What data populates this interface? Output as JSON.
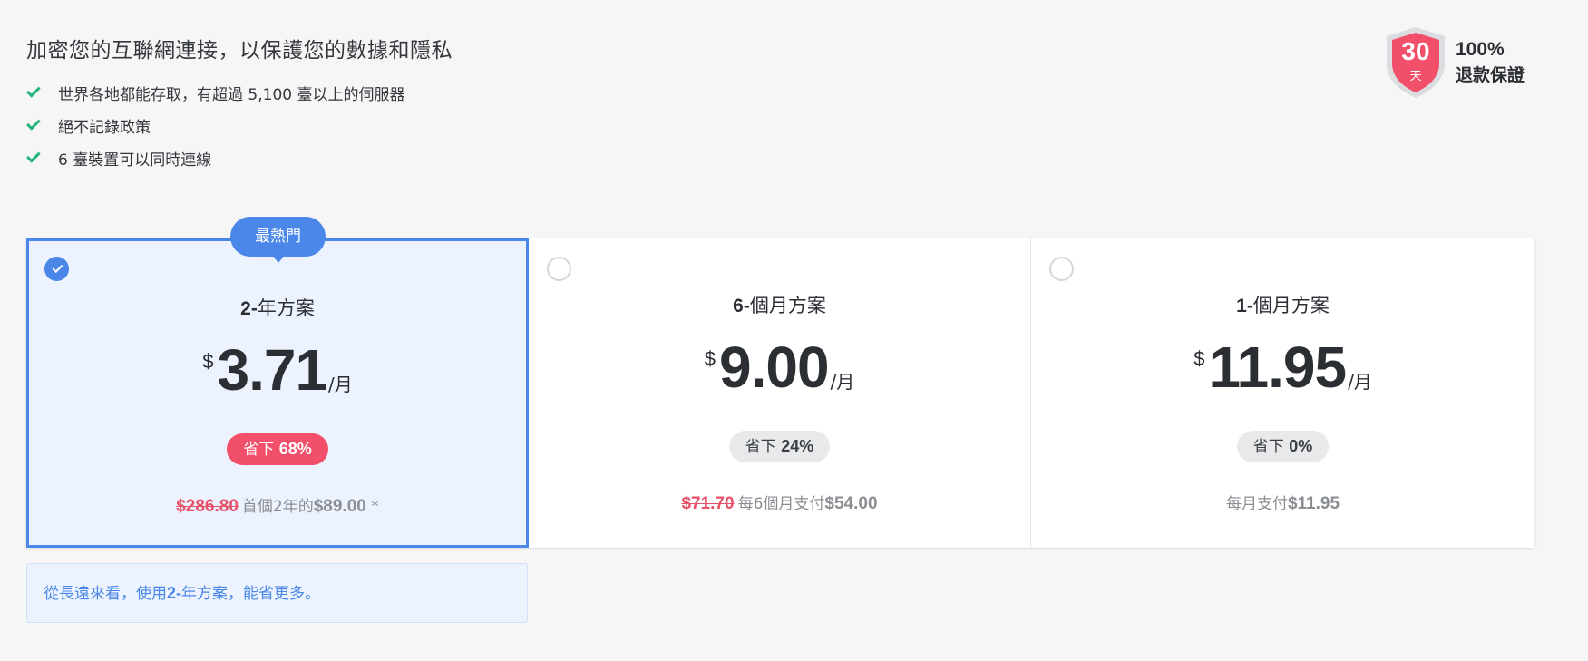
{
  "headline": "加密您的互聯網連接，以保護您的數據和隱私",
  "features": [
    "世界各地都能存取，有超過 5,100 臺以上的伺服器",
    "絕不記錄政策",
    "6 臺裝置可以同時連線"
  ],
  "guarantee": {
    "days": "30",
    "day_unit": "天",
    "percent": "100%",
    "label": "退款保證",
    "icon": "money-back-shield-icon"
  },
  "popular_badge": "最熱門",
  "plans": [
    {
      "selected": true,
      "name_bold": "2-",
      "name_rest": "年方案",
      "currency": "$",
      "price": "3.71",
      "per": "/月",
      "save_prefix": "省下",
      "save_value": "68%",
      "old_price": "$286.80",
      "billing_prefix": "首個2年的",
      "billing_amount": "$89.00",
      "billing_suffix": " *"
    },
    {
      "selected": false,
      "name_bold": "6-",
      "name_rest": "個月方案",
      "currency": "$",
      "price": "9.00",
      "per": "/月",
      "save_prefix": "省下",
      "save_value": "24%",
      "old_price": "$71.70",
      "billing_prefix": "每6個月支付",
      "billing_amount": "$54.00",
      "billing_suffix": ""
    },
    {
      "selected": false,
      "name_bold": "1-",
      "name_rest": "個月方案",
      "currency": "$",
      "price": "11.95",
      "per": "/月",
      "save_prefix": "省下",
      "save_value": "0%",
      "old_price": "",
      "billing_prefix": "每月支付",
      "billing_amount": "$11.95",
      "billing_suffix": ""
    }
  ],
  "note": {
    "prefix": "從長遠來看，使用",
    "bold": "2-",
    "suffix": "年方案，能省更多。"
  },
  "colors": {
    "accent": "#4a87e8",
    "hot": "#f2506a",
    "check": "#21b57a"
  }
}
